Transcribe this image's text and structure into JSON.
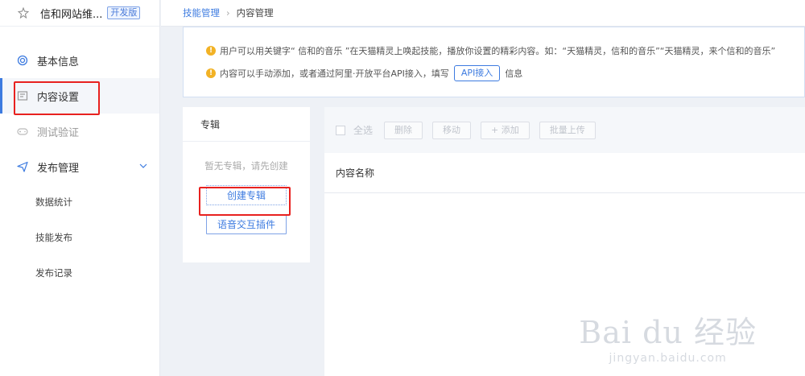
{
  "app": {
    "name": "信和网站维...",
    "badge": "开发版"
  },
  "breadcrumb": {
    "parent": "技能管理",
    "current": "内容管理"
  },
  "sidebar": {
    "items": [
      {
        "label": "基本信息",
        "icon": "target-icon"
      },
      {
        "label": "内容设置",
        "icon": "content-icon"
      },
      {
        "label": "测试验证",
        "icon": "gamepad-icon"
      },
      {
        "label": "发布管理",
        "icon": "send-icon"
      }
    ],
    "sub_items": [
      {
        "label": "数据统计"
      },
      {
        "label": "技能发布"
      },
      {
        "label": "发布记录"
      }
    ]
  },
  "notice": {
    "line1": "用户可以用关键字“ 信和的音乐 ”在天猫精灵上唤起技能，播放你设置的精彩内容。如：“天猫精灵，信和的音乐”“天猫精灵，来个信和的音乐”",
    "line2_before": "内容可以手动添加，或者通过阿里·开放平台API接入，填写",
    "api_button": "API接入",
    "line2_after": "信息"
  },
  "album": {
    "title": "专辑",
    "empty_text": "暂无专辑，请先创建",
    "create_button": "创建专辑",
    "voice_button": "语音交互插件"
  },
  "toolbar": {
    "select_all": "全选",
    "delete": "删除",
    "move": "移动",
    "add": "+ 添加",
    "batch_upload": "批量上传"
  },
  "table": {
    "column_name": "内容名称"
  },
  "watermark": {
    "brand": "Bai du 经验",
    "url": "jingyan.baidu.com"
  },
  "colors": {
    "accent": "#3d7be0",
    "highlight_box": "#e8211f",
    "warning": "#f2b225"
  }
}
